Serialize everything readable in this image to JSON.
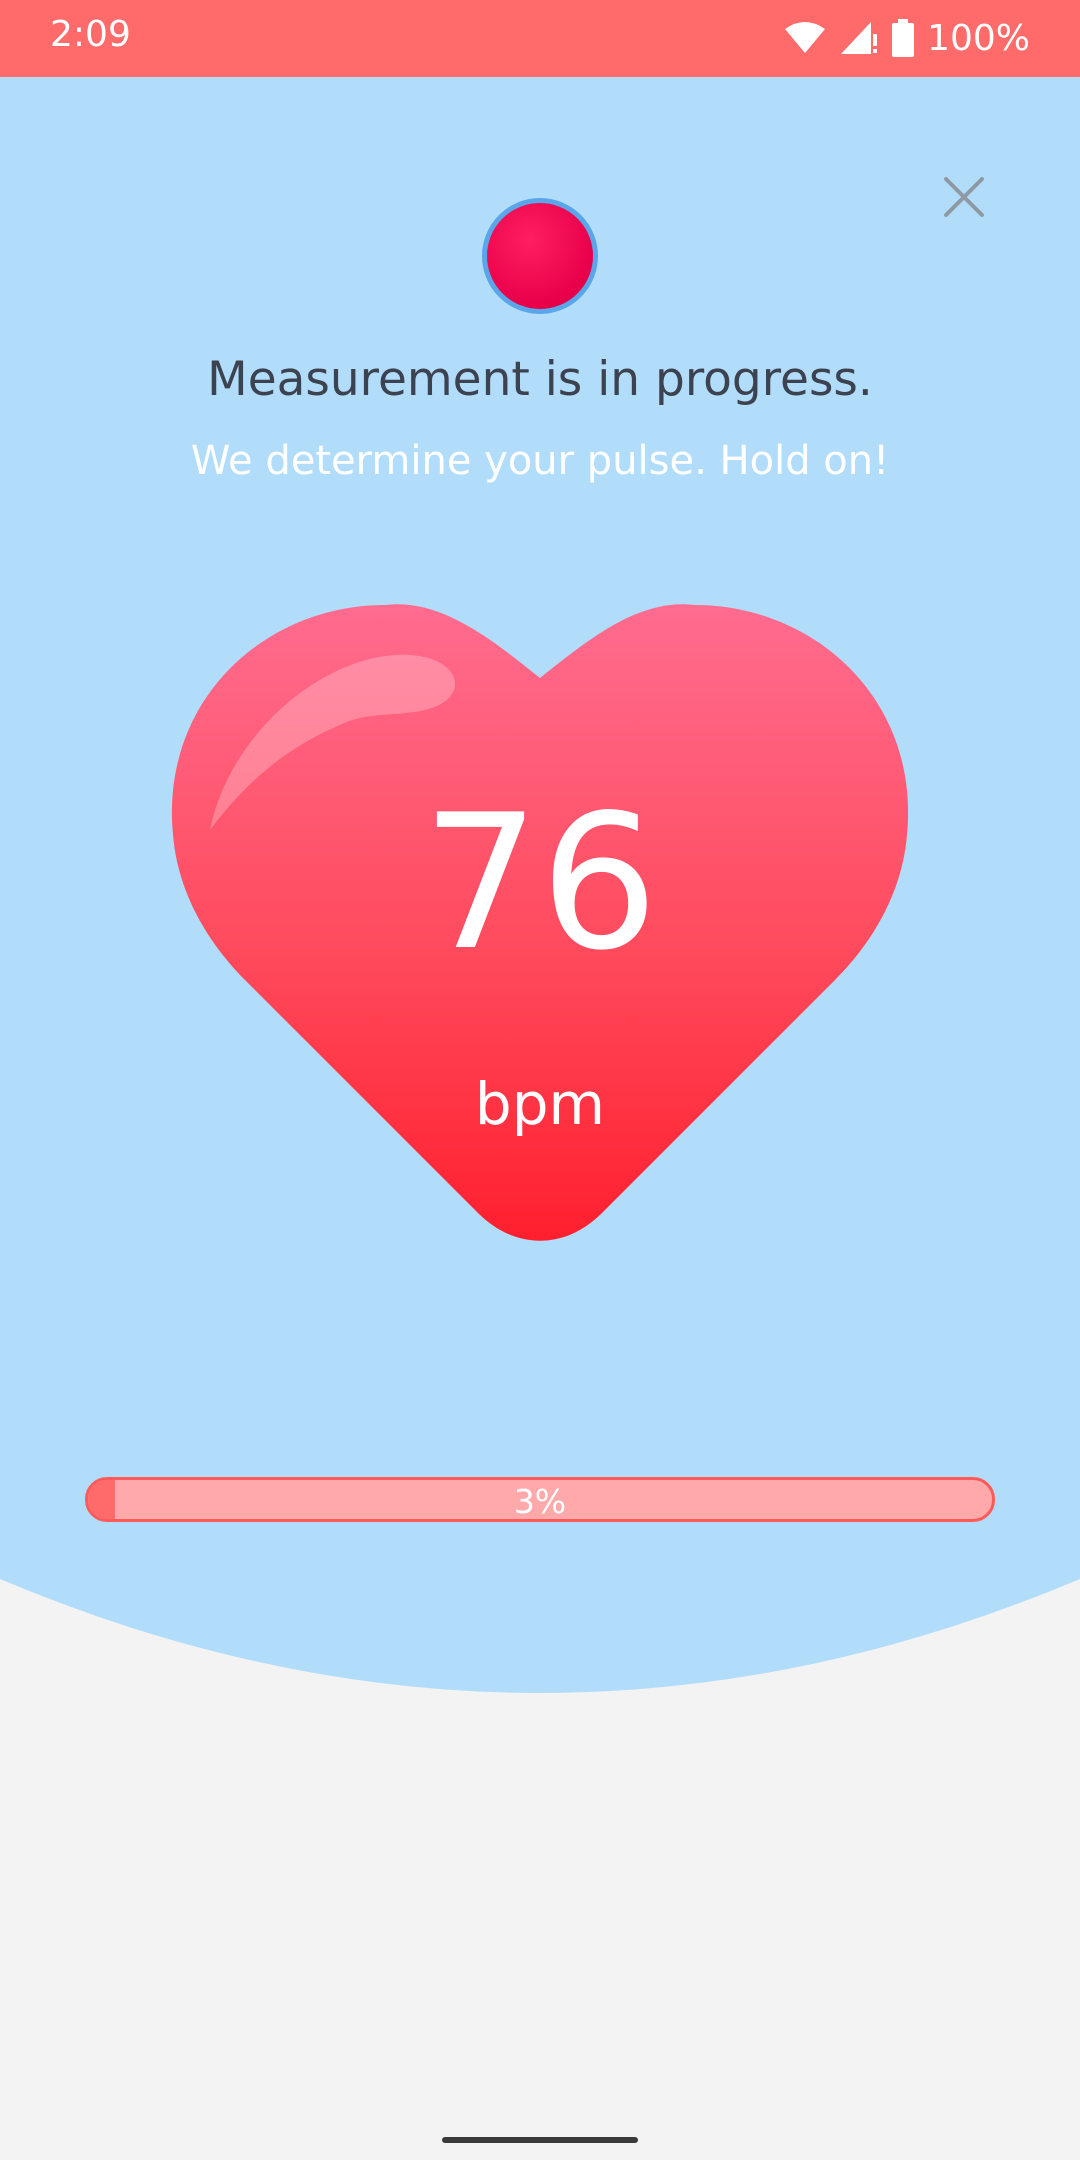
{
  "status_bar": {
    "time": "2:09",
    "battery": "100%",
    "icons": [
      "wifi-icon",
      "cell-signal-icon",
      "battery-icon"
    ]
  },
  "measurement": {
    "title": "Measurement is in progress.",
    "subtitle": "We determine your pulse. Hold on!",
    "bpm_value": "76",
    "bpm_unit": "bpm"
  },
  "progress": {
    "label": "3%",
    "value": 3
  },
  "icons": {
    "close": "close-icon",
    "record": "record-dot-icon",
    "heart": "heart-icon"
  },
  "colors": {
    "status_bar": "#ff6b6b",
    "background_blue": "#b2ddfa",
    "background_grey": "#f3f3f3",
    "heart_top": "#ff6c8f",
    "heart_bottom": "#ff1f2e",
    "progress_track": "#ffa9aa",
    "progress_fill": "#ff6a6a"
  }
}
